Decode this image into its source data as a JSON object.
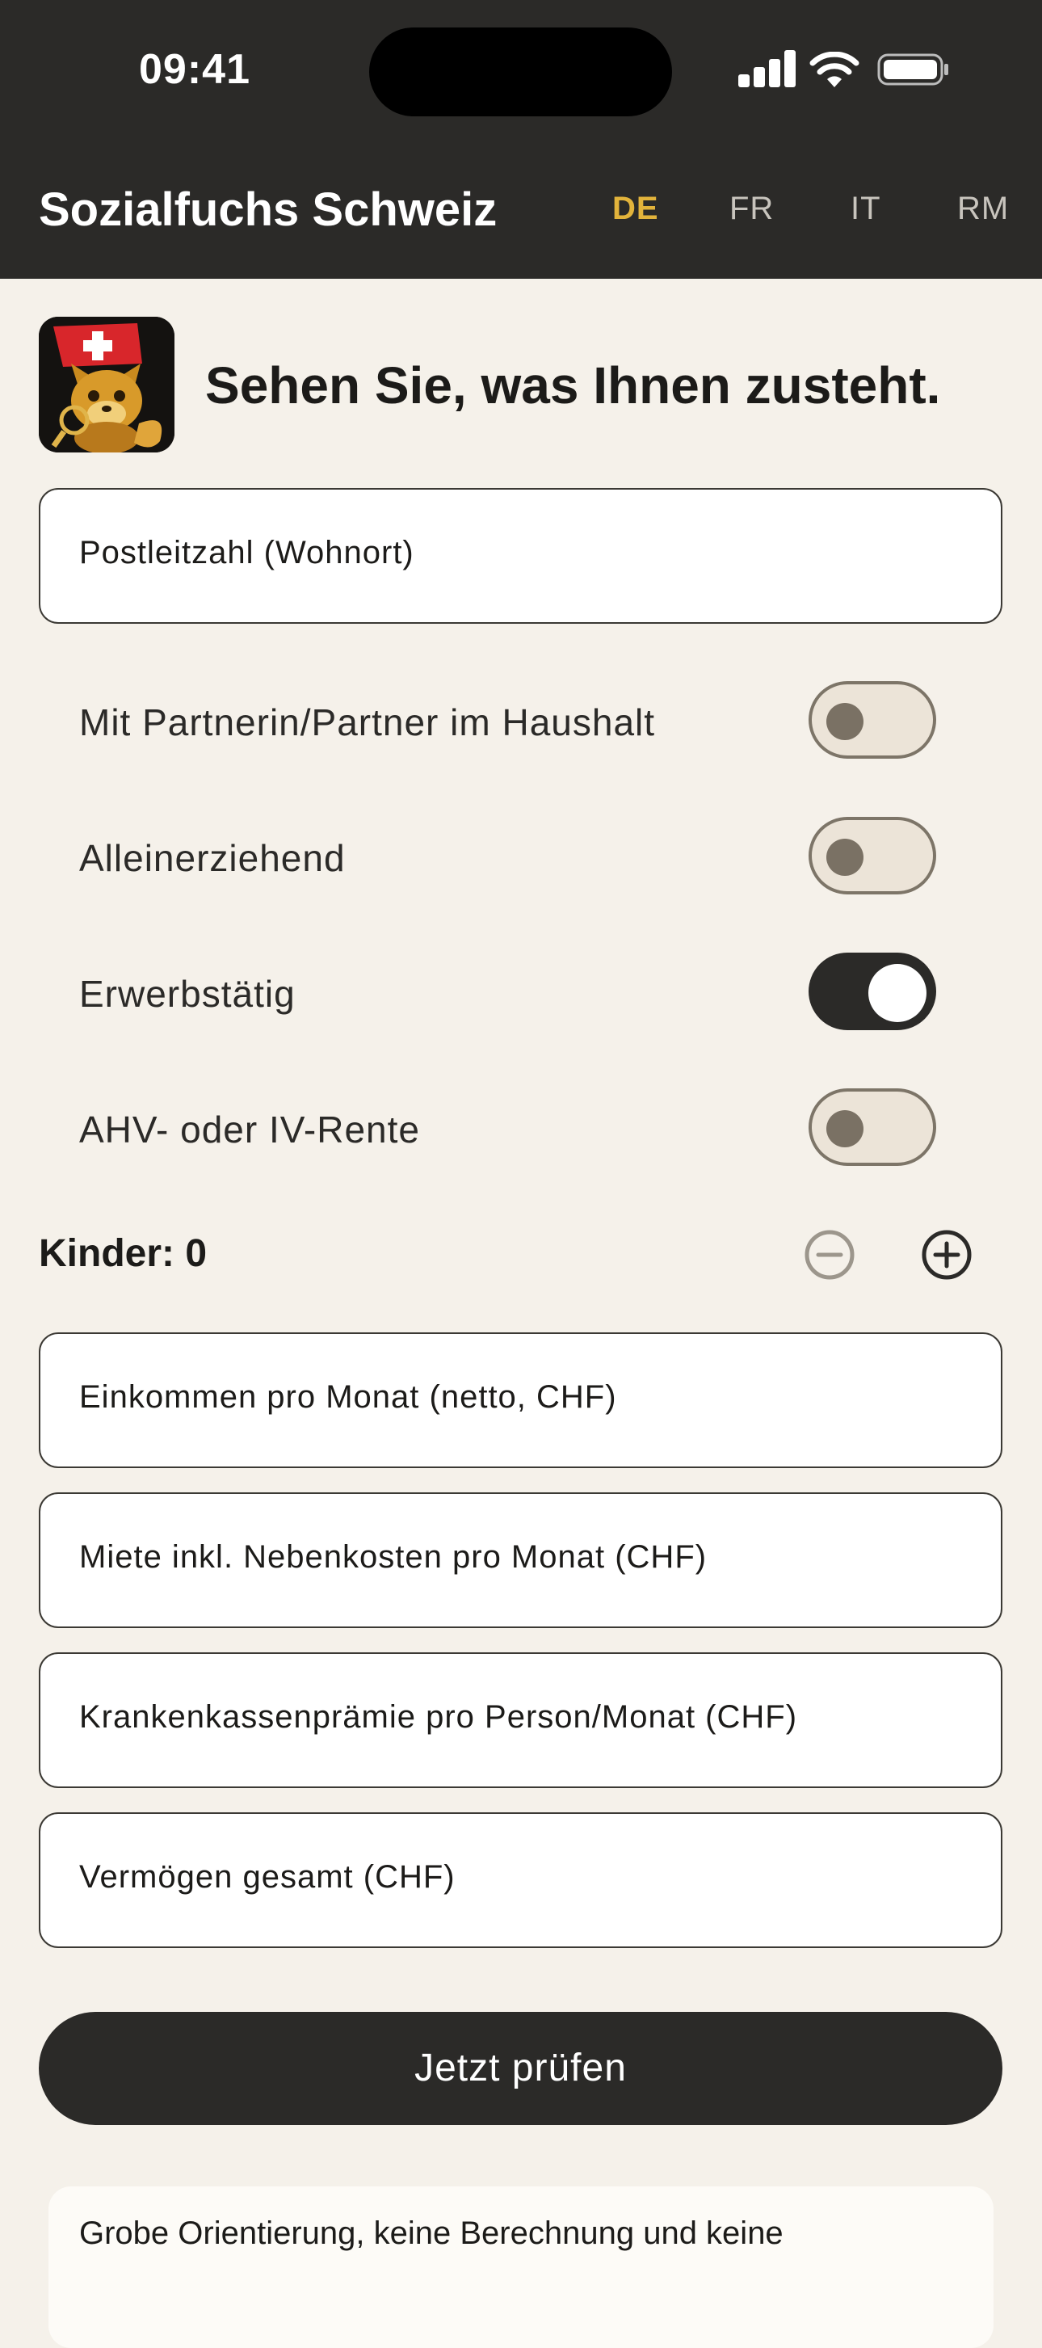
{
  "status": {
    "time": "09:41"
  },
  "header": {
    "title": "Sozialfuchs Schweiz",
    "languages": [
      "DE",
      "FR",
      "IT",
      "RM"
    ],
    "active_language": "DE"
  },
  "hero": {
    "title": "Sehen Sie, was Ihnen zusteht."
  },
  "form": {
    "postal_code_placeholder": "Postleitzahl (Wohnort)",
    "toggles": [
      {
        "label": "Mit Partnerin/Partner im Haushalt",
        "on": false
      },
      {
        "label": "Alleinerziehend",
        "on": false
      },
      {
        "label": "Erwerbstätig",
        "on": true
      },
      {
        "label": "AHV- oder IV-Rente",
        "on": false
      }
    ],
    "children_label": "Kinder:",
    "children_count": "0",
    "income_placeholder": "Einkommen pro Monat (netto, CHF)",
    "rent_placeholder": "Miete inkl. Nebenkosten pro Monat (CHF)",
    "premium_placeholder": "Krankenkassenprämie pro Person/Monat (CHF)",
    "assets_placeholder": "Vermögen gesamt (CHF)",
    "submit_label": "Jetzt prüfen"
  },
  "note": {
    "text": "Grobe Orientierung, keine Berechnung und keine"
  },
  "colors": {
    "accent": "#e2b33b",
    "dark": "#2b2a28",
    "background": "#f5f1ea"
  }
}
